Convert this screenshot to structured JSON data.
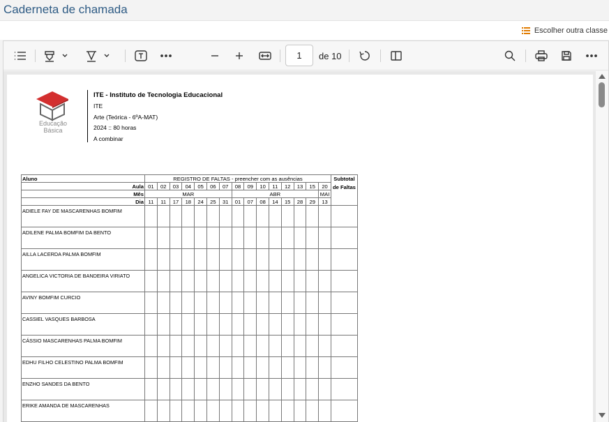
{
  "header": {
    "title": "Caderneta de chamada"
  },
  "class_bar": {
    "choose_class": "Escolher outra classe"
  },
  "viewer": {
    "page_current": "1",
    "page_total": "de 10"
  },
  "document": {
    "institution": "ITE - Instituto de Tecnologia Educacional",
    "abbr": "ITE",
    "course": "Arte (Teórica - 6ºA-MAT)",
    "hours": "2024 :: 80 horas",
    "schedule": "A combinar",
    "logo_line1": "Educação",
    "logo_line2": "Básica",
    "table": {
      "col_student": "Aluno",
      "col_register": "REGISTRO DE FALTAS - preencher com as ausências",
      "col_subtotal": "Subtotal de Faltas",
      "label_aula": "Aula",
      "label_mes": "Mês",
      "label_dia": "Dia",
      "aulas": [
        "01",
        "02",
        "03",
        "04",
        "05",
        "06",
        "07",
        "08",
        "09",
        "10",
        "11",
        "12",
        "13",
        "15",
        "20"
      ],
      "months": [
        {
          "name": "MAR",
          "span": 7
        },
        {
          "name": "ABR",
          "span": 7
        },
        {
          "name": "MAI",
          "span": 1
        }
      ],
      "dias": [
        "11",
        "11",
        "17",
        "18",
        "24",
        "25",
        "31",
        "01",
        "07",
        "08",
        "14",
        "15",
        "28",
        "29",
        "13"
      ],
      "students": [
        "ADIELE FAY DE MASCARENHAS BOMFIM",
        "ADILENE PALMA BOMFIM DA BENTO",
        "AILLA LACERDA PALMA BOMFIM",
        "ANGELICA VICTORIA DE BANDEIRA VIRIATO",
        "AVINY BOMFIM CURCIO",
        "CASSIEL VASQUES BARBOSA",
        "CÁSSIO MASCARENHAS PALMA BOMFIM",
        "EDHU FILHO CELESTINO PALMA BOMFIM",
        "ENZHO SANDES DA BENTO",
        "ERIKE AMANDA DE MASCARENHAS"
      ]
    }
  },
  "colors": {
    "title": "#2f5c85",
    "accent_orange": "#e07b00",
    "logo_red": "#d32f2f"
  }
}
